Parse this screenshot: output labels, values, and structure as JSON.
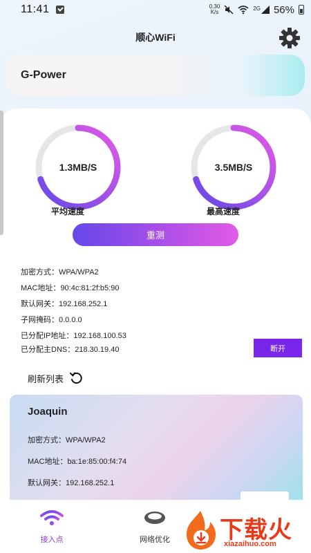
{
  "status_bar": {
    "time": "11:41",
    "speed_value": "0.30",
    "speed_unit": "K/s",
    "network": "2G",
    "battery": "56%"
  },
  "header": {
    "title": "顺心WiFi"
  },
  "wifi": {
    "name": "G-Power"
  },
  "speed": {
    "average_value": "1.3MB/S",
    "average_label": "平均速度",
    "max_value": "3.5MB/S",
    "max_label": "最高速度"
  },
  "retest_label": "重测",
  "info": {
    "encryption": "加密方式：WPA/WPA2",
    "mac": "MAC地址：90:4c:81:2f:b5:90",
    "gateway": "默认网关：192.168.252.1",
    "subnet": "子网掩码：0.0.0.0",
    "ip": "已分配IP地址：192.168.100.53",
    "dns": "已分配主DNS：218.30.19.40"
  },
  "disconnect_label": "断开",
  "refresh_label": "刷新列表",
  "networks": [
    {
      "name": "Joaquin",
      "encryption": "加密方式：WPA/WPA2",
      "mac": "MAC地址：ba:1e:85:00:f4:74",
      "gateway": "默认网关：192.168.252.1"
    }
  ],
  "nav": {
    "access_point": "接入点",
    "optimize": "网络优化"
  },
  "watermark": {
    "text": "下载火",
    "sub": "xiazaihuo.com"
  },
  "colors": {
    "accent": "#7a25ea",
    "gauge_gradient_start": "#6448e8",
    "gauge_gradient_end": "#e25ae6",
    "gauge_track": "#e6e6e6"
  },
  "gauges": {
    "average_fraction": 0.7,
    "max_fraction": 0.7
  }
}
